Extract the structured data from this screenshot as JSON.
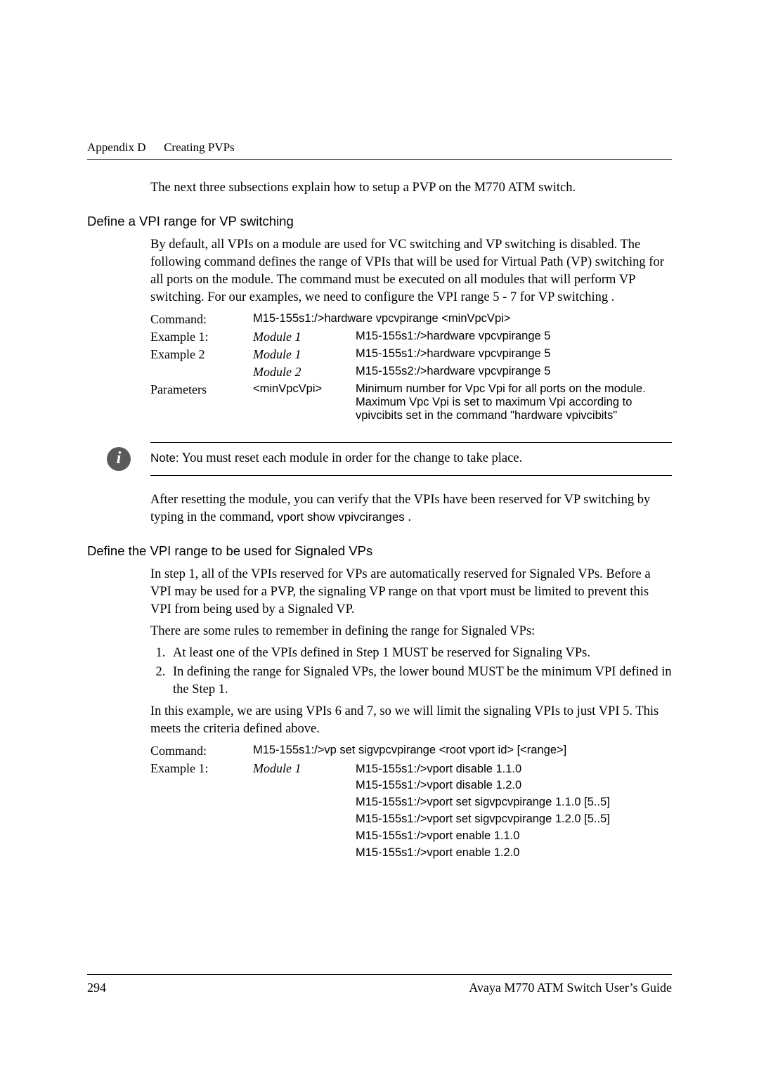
{
  "header": {
    "appendix": "Appendix D",
    "title": "Creating PVPs"
  },
  "intro": "The next three subsections explain how to setup a PVP on the M770 ATM switch.",
  "section1": {
    "heading": "Define a VPI range for VP switching",
    "para": "By default, all VPIs on a module are used for VC switching and VP switching is disabled.  The following command defines the range of VPIs that will be used for Virtual Path (VP) switching for all ports on the module. The command must be executed on all modules that will perform VP switching. For our examples, we need to configure the VPI range 5 - 7 for VP switching .",
    "rows": {
      "command_label": "Command:",
      "command_val": "M15-155s1:/>hardware vpcvpirange <minVpcVpi>",
      "ex1_label": "Example 1:",
      "ex1_mod": "Module 1",
      "ex1_val": "M15-155s1:/>hardware vpcvpirange 5",
      "ex2_label": "Example 2",
      "ex2_mod1": "Module 1",
      "ex2_val1": "M15-155s1:/>hardware vpcvpirange 5",
      "ex2_mod2": "Module 2",
      "ex2_val2": "M15-155s2:/>hardware vpcvpirange 5",
      "params_label": "Parameters",
      "params_mid": "<minVpcVpi>",
      "params_val": "Minimum number for Vpc Vpi for all ports on the module. Maximum Vpc Vpi is set to maximum Vpi according to vpivcibits set in the command \"hardware vpivcibits\""
    }
  },
  "note": {
    "label": "Note:",
    "text": " You must reset each module in order for the change to take place."
  },
  "after_note": {
    "line1": "After resetting the module, you can verify that the VPIs have been reserved for VP switching by typing in the command, ",
    "cmd": "vport show vpivciranges",
    "tail": " ."
  },
  "section2": {
    "heading": "Define the VPI range to be used for Signaled VPs",
    "para1": "In step 1, all of the VPIs reserved for VPs are automatically reserved for Signaled VPs.  Before a VPI may be used for a PVP, the signaling VP range on that vport must be limited to prevent this VPI from being used by a Signaled VP.",
    "para2": "There are some rules to remember in defining the range for Signaled VPs:",
    "rule1": "At least one of the VPIs defined in Step 1 MUST be reserved for Signaling VPs.",
    "rule2": "In defining the range for Signaled VPs, the lower bound MUST be the minimum VPI defined in the Step 1.",
    "para3": "In this example, we are using VPIs 6 and 7, so we will limit the signaling VPIs to just VPI 5.  This meets the criteria defined above.",
    "rows": {
      "command_label": "Command:",
      "command_val": "M15-155s1:/>vp set sigvpcvpirange <root vport id> [<range>]",
      "ex1_label": "Example 1:",
      "ex1_mod": "Module 1",
      "ex1_lines": [
        "M15-155s1:/>vport disable 1.1.0",
        "M15-155s1:/>vport disable 1.2.0",
        "M15-155s1:/>vport set sigvpcvpirange 1.1.0 [5..5]",
        "M15-155s1:/>vport set sigvpcvpirange 1.2.0 [5..5]",
        "M15-155s1:/>vport enable 1.1.0",
        "M15-155s1:/>vport enable 1.2.0"
      ]
    }
  },
  "footer": {
    "page": "294",
    "doc": "Avaya M770 ATM Switch User’s Guide"
  }
}
